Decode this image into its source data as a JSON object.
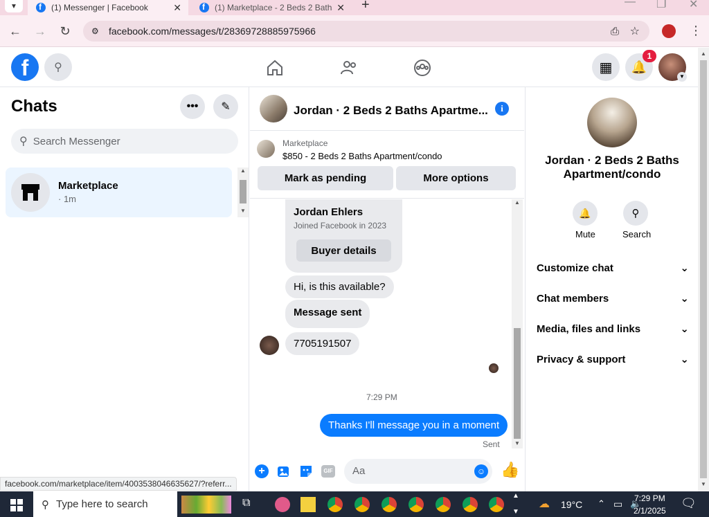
{
  "browser": {
    "tabs": [
      {
        "title": "(1) Messenger | Facebook"
      },
      {
        "title": "(1) Marketplace - 2 Beds 2 Baths"
      }
    ],
    "new_tab": "+",
    "url": "facebook.com/messages/t/28369728885975966",
    "status_url": "facebook.com/marketplace/item/4003538046635627/?referr..."
  },
  "header": {
    "notification_count": "1"
  },
  "chats": {
    "title": "Chats",
    "search_placeholder": "Search Messenger",
    "items": [
      {
        "name": "Marketplace",
        "time": "· 1m"
      }
    ]
  },
  "conversation": {
    "title": "Jordan · 2 Beds 2 Baths Apartme...",
    "listing_source": "Marketplace",
    "listing_title": "$850 - 2 Beds 2 Baths Apartment/condo",
    "mark_pending": "Mark as pending",
    "more_options": "More options",
    "buyer_name": "Jordan Ehlers",
    "buyer_joined": "Joined Facebook in 2023",
    "buyer_details": "Buyer details",
    "messages": [
      {
        "text": "Hi, is this available?"
      },
      {
        "text": "Message sent"
      },
      {
        "text": "7705191507"
      }
    ],
    "timestamp": "7:29 PM",
    "outgoing": "Thanks I'll message you in a moment",
    "sent_status": "Sent",
    "composer_placeholder": "Aa"
  },
  "info_panel": {
    "name": "Jordan · 2 Beds 2 Baths Apartment/condo",
    "mute": "Mute",
    "search": "Search",
    "sections": [
      "Customize chat",
      "Chat members",
      "Media, files and links",
      "Privacy & support"
    ]
  },
  "taskbar": {
    "search_placeholder": "Type here to search",
    "weather": "19°C",
    "time": "7:29 PM",
    "date": "2/1/2025"
  },
  "colors": {
    "accent": "#1877f2",
    "bubble": "#e9eaed",
    "chrome": "#fbeef3"
  }
}
